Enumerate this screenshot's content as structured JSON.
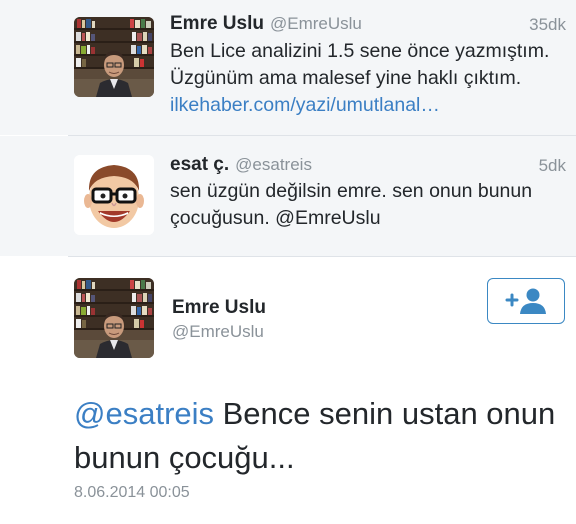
{
  "tweets": [
    {
      "name": "Emre Uslu",
      "handle": "@EmreUslu",
      "time": "35dk",
      "line1": "Ben Lice analizini 1.5 sene önce yazmıştım.",
      "line2": "Üzgünüm ama malesef yine haklı çıktım.",
      "link": "ilkehaber.com/yazi/umutlanal…"
    },
    {
      "name": "esat ç.",
      "handle": "@esatreis",
      "time": "5dk",
      "line1": "sen üzgün değilsin emre. sen onun bunun",
      "line2": "çocuğusun. @EmreUslu"
    }
  ],
  "profile": {
    "name": "Emre Uslu",
    "handle": "@EmreUslu"
  },
  "main_tweet": {
    "mention": "@esatreis",
    "text_line1": " Bence senin ustan onun",
    "text_line2": "bunun çocuğu...",
    "timestamp": "8.06.2014 00:05"
  },
  "colors": {
    "link": "#3b7fc4",
    "follow_accent": "#3b88c3",
    "row_background": "#f4f6f8"
  },
  "icons": {
    "follow": "add-user-icon"
  }
}
